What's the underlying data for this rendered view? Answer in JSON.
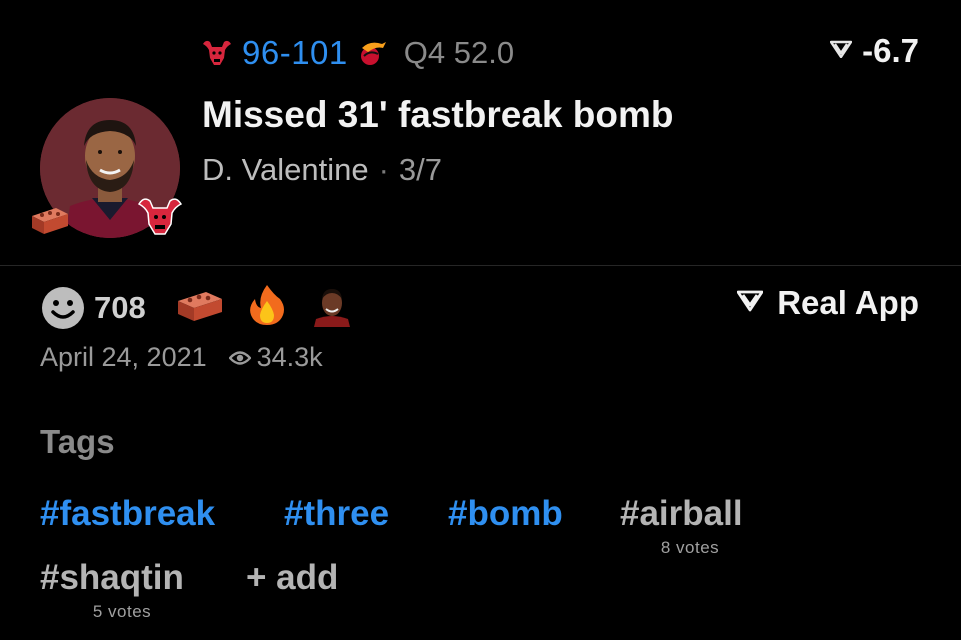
{
  "header": {
    "score": "96-101",
    "clock": "Q4 52.0",
    "home_team_icon": "bulls-logo-icon",
    "away_team_icon": "heat-logo-icon",
    "delta": "-6.7",
    "delta_icon": "real-app-logo-icon"
  },
  "play": {
    "title": "Missed 31' fastbreak bomb",
    "player": "D. Valentine",
    "separator": "·",
    "shot_count": "3/7"
  },
  "reactions": {
    "count": "708",
    "items": [
      "brick-icon",
      "fire-icon",
      "player-face-icon"
    ]
  },
  "real_app": {
    "label": "Real App"
  },
  "meta": {
    "date": "April 24, 2021",
    "views": "34.3k"
  },
  "tags": {
    "heading": "Tags",
    "items": [
      {
        "label": "#fastbreak",
        "votes": ""
      },
      {
        "label": "#three",
        "votes": ""
      },
      {
        "label": "#bomb",
        "votes": ""
      },
      {
        "label": "#airball",
        "votes": "8 votes"
      },
      {
        "label": "#shaqtin",
        "votes": "5 votes"
      }
    ],
    "add_label": "+ add"
  },
  "colors": {
    "accent": "#2f8ff0",
    "background": "#000000",
    "muted": "#9a9a9a"
  }
}
